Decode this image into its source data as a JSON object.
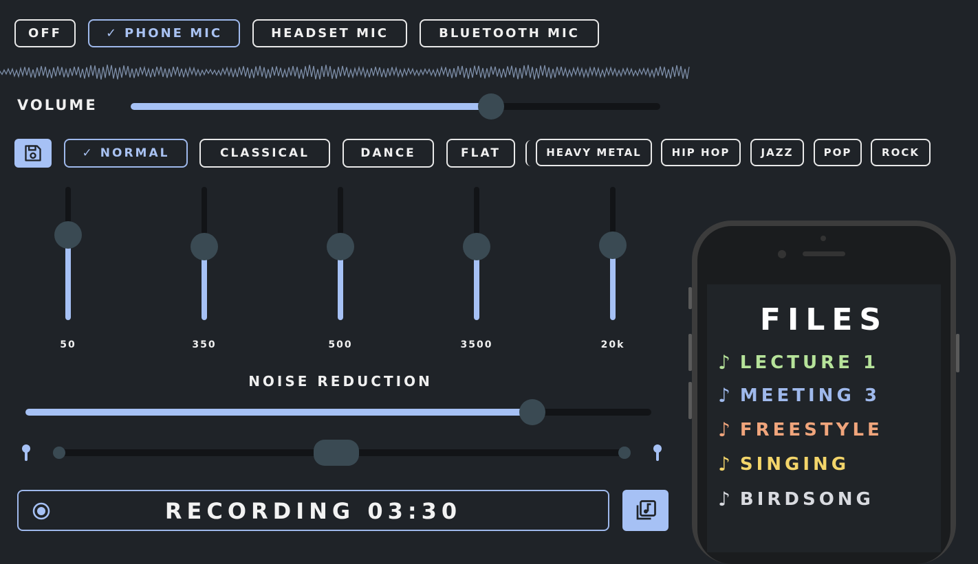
{
  "mic_modes": [
    {
      "label": "OFF",
      "selected": false
    },
    {
      "label": "PHONE MIC",
      "selected": true
    },
    {
      "label": "HEADSET MIC",
      "selected": false
    },
    {
      "label": "BLUETOOTH MIC",
      "selected": false
    }
  ],
  "check_glyph": "✓",
  "volume": {
    "label": "VOLUME",
    "value_fraction": 0.68
  },
  "save_icon": "floppy-disk-icon",
  "eq_presets": [
    {
      "label": "NORMAL",
      "selected": true
    },
    {
      "label": "CLASSICAL",
      "selected": false
    },
    {
      "label": "DANCE",
      "selected": false
    },
    {
      "label": "FLAT",
      "selected": false
    },
    {
      "label": "HEAVY METAL",
      "selected": false
    },
    {
      "label": "HIP HOP",
      "selected": false
    },
    {
      "label": "JAZZ",
      "selected": false
    },
    {
      "label": "POP",
      "selected": false
    },
    {
      "label": "ROCK",
      "selected": false
    }
  ],
  "eq_bands": [
    {
      "freq": "50",
      "level": 0.64
    },
    {
      "freq": "350",
      "level": 0.55
    },
    {
      "freq": "500",
      "level": 0.55
    },
    {
      "freq": "3500",
      "level": 0.55
    },
    {
      "freq": "20k",
      "level": 0.56
    }
  ],
  "noise_reduction": {
    "label": "NOISE REDUCTION",
    "value_fraction": 0.81
  },
  "balance": {
    "value_fraction": 0.5
  },
  "recording": {
    "label": "RECORDING",
    "time": "03:30"
  },
  "files": {
    "title": "FILES",
    "items": [
      {
        "name": "LECTURE 1",
        "color": "#b6e39a"
      },
      {
        "name": "MEETING 3",
        "color": "#9fb9ec"
      },
      {
        "name": "FREESTYLE",
        "color": "#f0a57c"
      },
      {
        "name": "SINGING",
        "color": "#f3d56a"
      },
      {
        "name": "BIRDSONG",
        "color": "#d9dbe0"
      }
    ]
  },
  "colors": {
    "accent": "#a6c1f5",
    "background": "#1f2328",
    "knob": "#3a4a53"
  }
}
